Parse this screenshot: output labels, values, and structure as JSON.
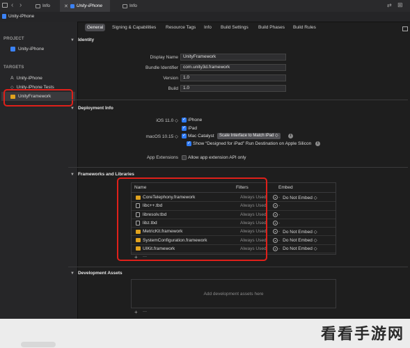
{
  "tabs": [
    {
      "label": "Info"
    },
    {
      "label": "Unity-iPhone"
    },
    {
      "label": "Info"
    }
  ],
  "project_bar": {
    "title": "Unity-iPhone"
  },
  "sidebar": {
    "project_title": "PROJECT",
    "project_item": "Unity-iPhone",
    "targets_title": "TARGETS",
    "targets": [
      "Unity-iPhone",
      "Unity-iPhone Tests",
      "UnityFramework"
    ]
  },
  "segments": [
    "General",
    "Signing & Capabilities",
    "Resource Tags",
    "Info",
    "Build Settings",
    "Build Phases",
    "Build Rules"
  ],
  "identity": {
    "title": "Identity",
    "display_name_label": "Display Name",
    "display_name": "UnityFramework",
    "bundle_label": "Bundle Identifier",
    "bundle": "com.unity3d.framework",
    "version_label": "Version",
    "version": "1.0",
    "build_label": "Build",
    "build": "1.0"
  },
  "deployment": {
    "title": "Deployment Info",
    "ios_label": "iOS 11.0 ◇",
    "iphone": "iPhone",
    "ipad": "iPad",
    "macos_label": "macOS 10.15 ◇",
    "mac_catalyst": "Mac Catalyst",
    "scale_select": "Scale Interface to Match iPad ◇",
    "show_designed": "Show “Designed for iPad” Run Destination on Apple Silicon",
    "app_ext_label": "App Extensions",
    "allow_ext": "Allow app extension API only"
  },
  "frameworks": {
    "title": "Frameworks and Libraries",
    "col_name": "Name",
    "col_filters": "Filters",
    "col_embed": "Embed",
    "rows": [
      {
        "name": "CoreTelephony.framework",
        "filter": "Always Used",
        "embed": "Do Not Embed ◇",
        "type": "framework"
      },
      {
        "name": "libc++.tbd",
        "filter": "Always Used",
        "embed": "",
        "type": "file"
      },
      {
        "name": "libresolv.tbd",
        "filter": "Always Used",
        "embed": "",
        "type": "file"
      },
      {
        "name": "libz.tbd",
        "filter": "Always Used",
        "embed": "",
        "type": "file"
      },
      {
        "name": "MetricKit.framework",
        "filter": "Always Used",
        "embed": "Do Not Embed ◇",
        "type": "framework"
      },
      {
        "name": "SystemConfiguration.framework",
        "filter": "Always Used",
        "embed": "Do Not Embed ◇",
        "type": "framework"
      },
      {
        "name": "UIKit.framework",
        "filter": "Always Used",
        "embed": "Do Not Embed ◇",
        "type": "framework"
      }
    ],
    "add": "+",
    "remove": "—"
  },
  "dev_assets": {
    "title": "Development Assets",
    "placeholder": "Add development assets here",
    "add": "+",
    "remove": "—"
  },
  "watermark": "看看手游网",
  "colors": {
    "accent": "#2f7bf6",
    "highlight": "#e0201a"
  }
}
